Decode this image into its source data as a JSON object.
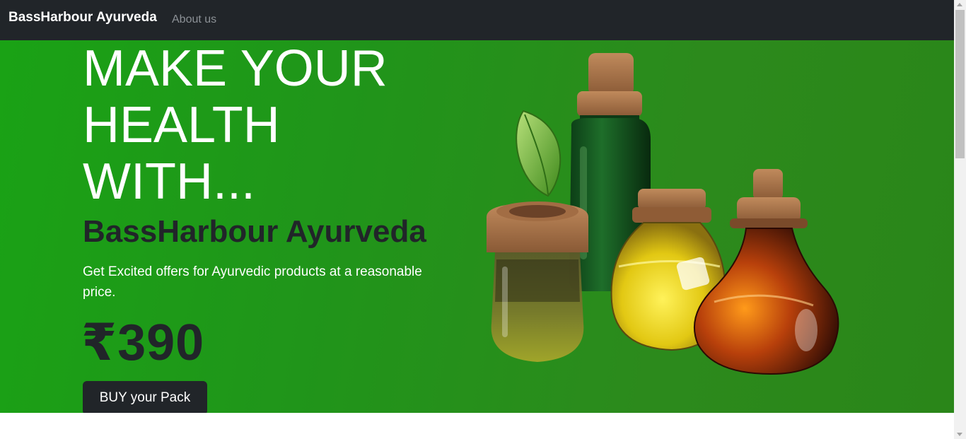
{
  "navbar": {
    "brand": "BassHarbour Ayurveda",
    "links": [
      {
        "label": "About us"
      }
    ]
  },
  "hero": {
    "headline_lines": [
      "MAKE YOUR",
      "HEALTH",
      "WITH..."
    ],
    "company": "BassHarbour Ayurveda",
    "tagline": "Get Excited offers for Ayurvedic products at a reasonable price.",
    "price": "₹390",
    "cta_label": "BUY your Pack",
    "image_icon": "ayurvedic-oil-bottles-image"
  },
  "colors": {
    "navbar_bg": "#212529",
    "hero_green": "#1fa016",
    "dark_text": "#212529",
    "button_bg": "#212529"
  }
}
